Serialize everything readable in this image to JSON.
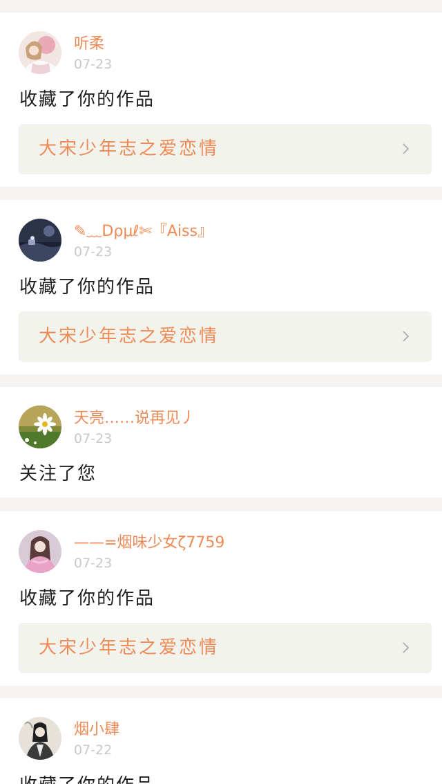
{
  "colors": {
    "page_background": "#f5f4f2",
    "card_background": "#ffffff",
    "accent": "#ee8a55",
    "date": "#c8c8c8",
    "action_text": "#1f1f1f",
    "work_background": "#f3f3ed",
    "chevron": "#b4b4b4"
  },
  "feed": [
    {
      "username": "听柔",
      "date": "07-23",
      "action": "收藏了你的作品",
      "work_title": "大宋少年志之爱恋情",
      "avatar_icon": "girl-with-pink-balloon-avatar"
    },
    {
      "username": "✎﹏Dρμℓ✄『Aiss』",
      "date": "07-23",
      "action": "收藏了你的作品",
      "work_title": "大宋少年志之爱恋情",
      "avatar_icon": "dark-night-scene-avatar"
    },
    {
      "username": "天亮……说再见丿",
      "date": "07-23",
      "action": "关注了您",
      "avatar_icon": "daisy-flower-avatar"
    },
    {
      "username": "——=烟味少女ζ7759",
      "date": "07-23",
      "action": "收藏了你的作品",
      "work_title": "大宋少年志之爱恋情",
      "avatar_icon": "girl-in-pink-avatar"
    },
    {
      "username": "烟小肆",
      "date": "07-22",
      "action": "收藏了你的作品",
      "avatar_icon": "ink-painting-man-avatar"
    }
  ]
}
